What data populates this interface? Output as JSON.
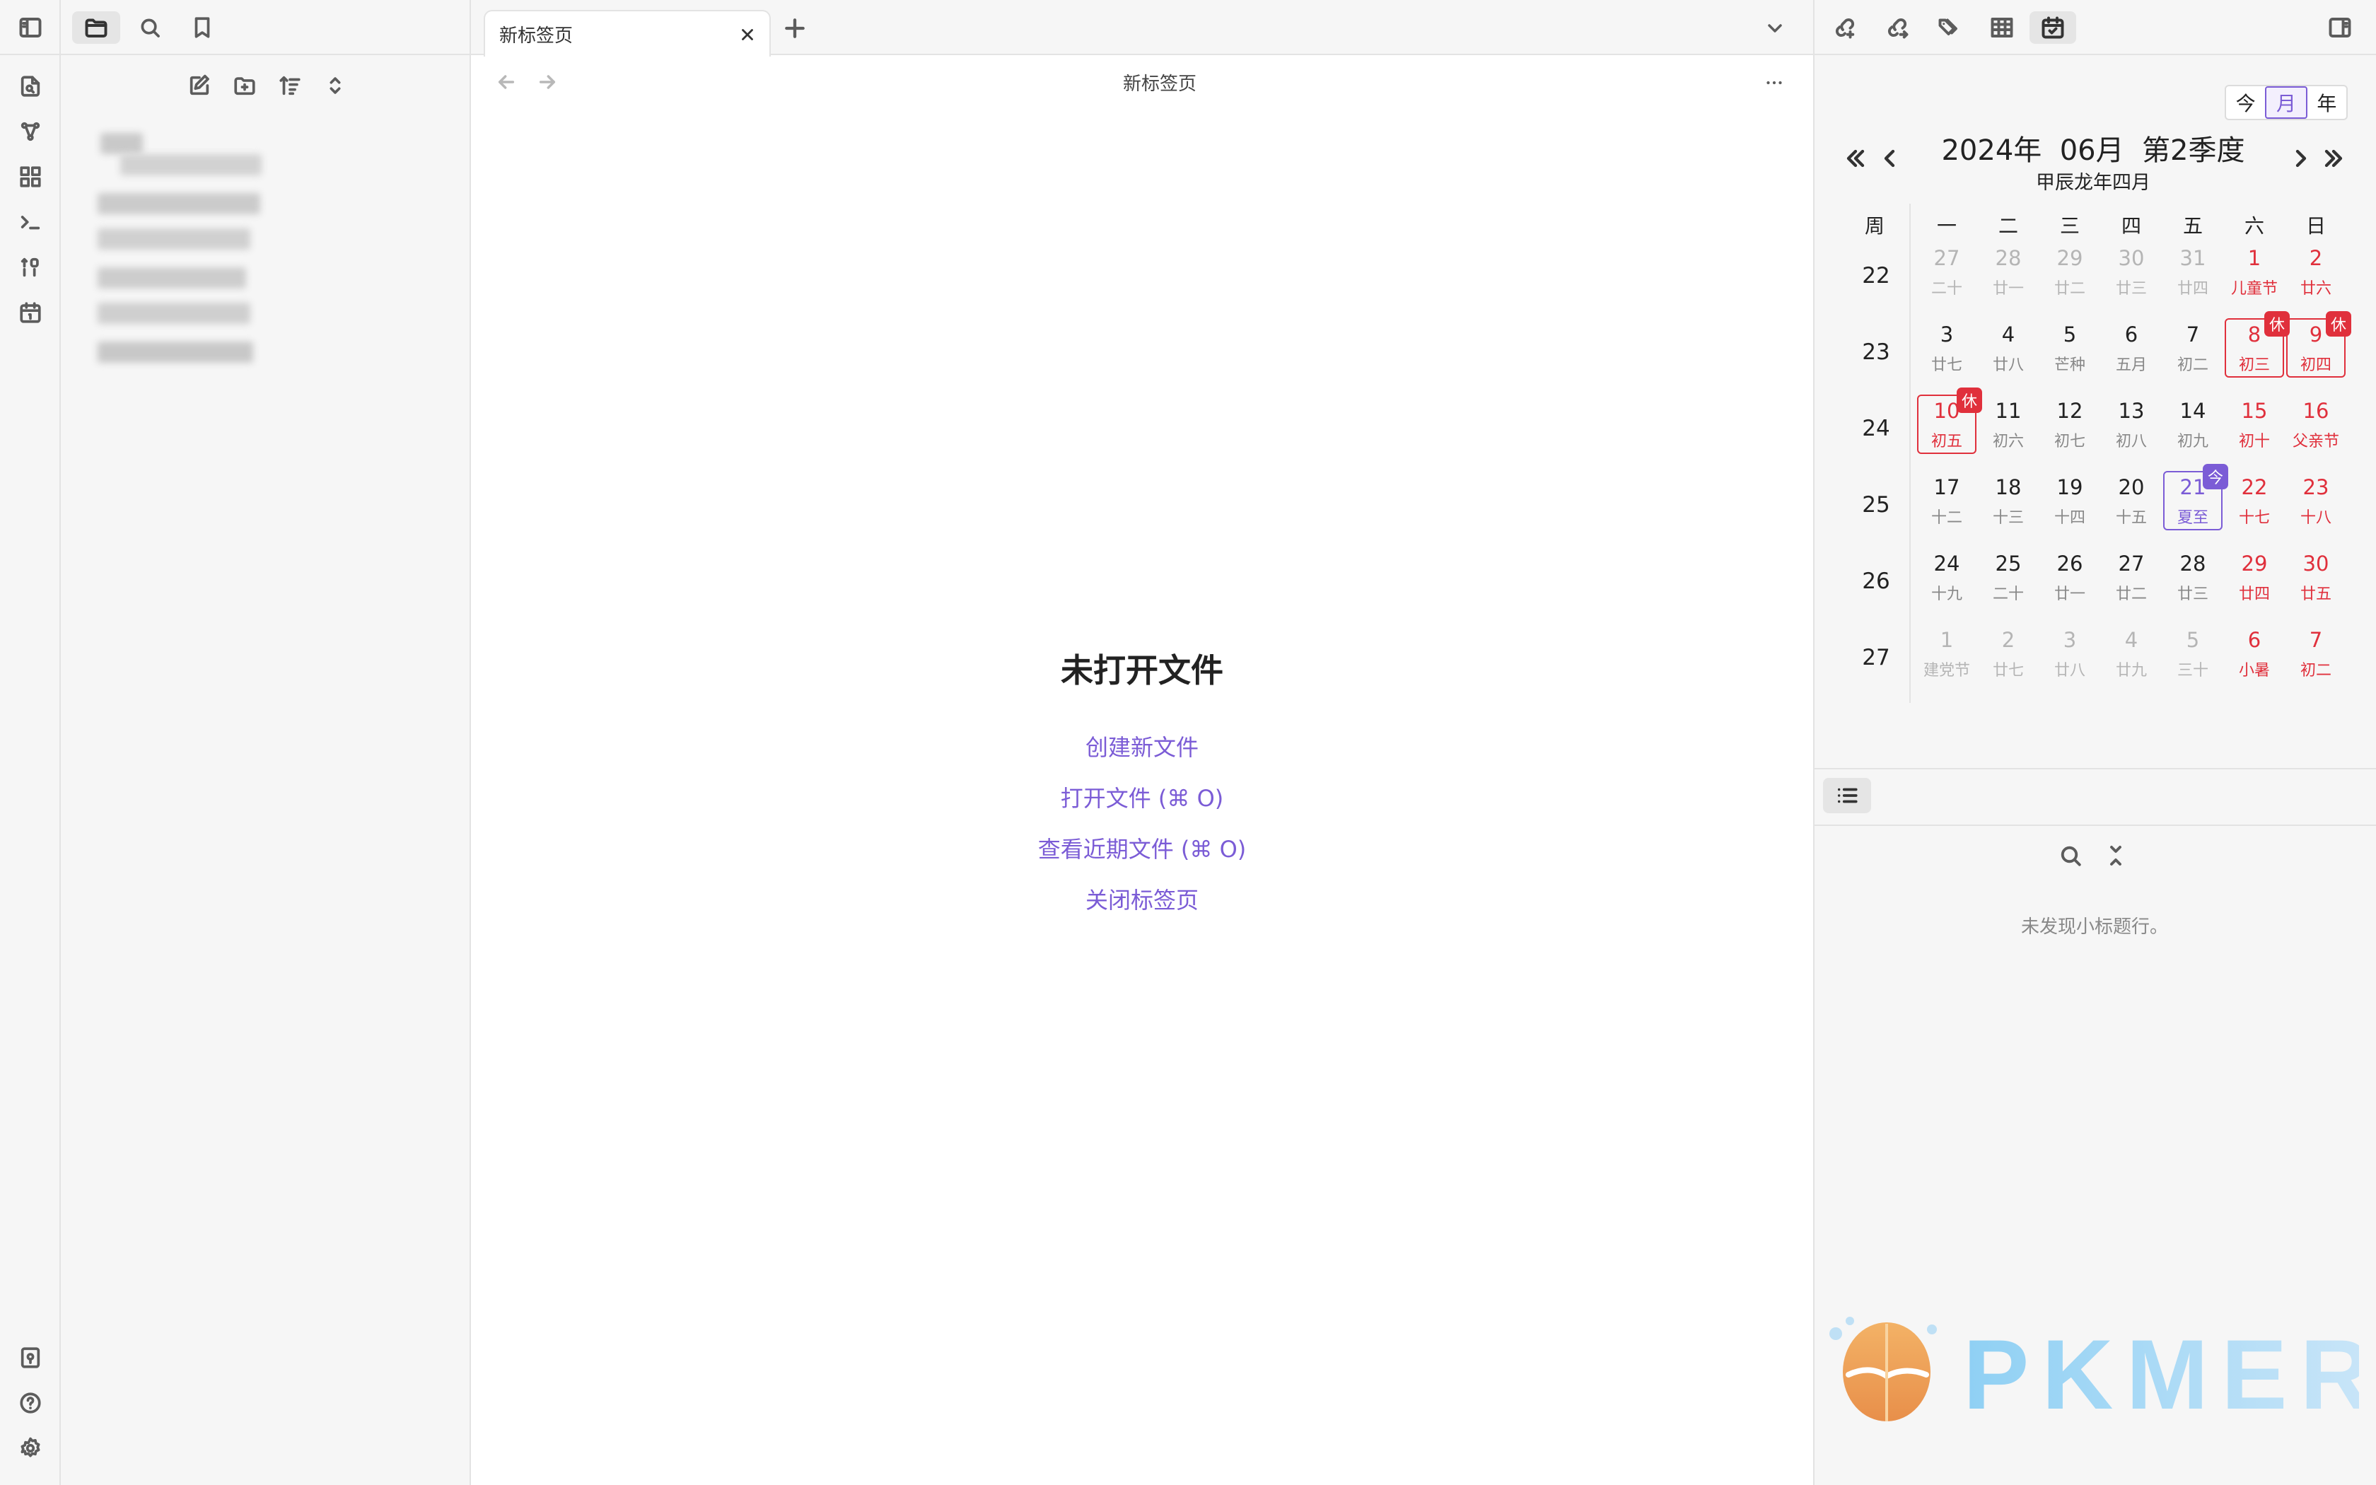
{
  "tabs": {
    "active_title": "新标签页"
  },
  "view": {
    "title": "新标签页"
  },
  "empty_state": {
    "title": "未打开文件",
    "links": [
      "创建新文件",
      "打开文件 (⌘ O)",
      "查看近期文件 (⌘ O)",
      "关闭标签页"
    ]
  },
  "calendar": {
    "view_modes": [
      "今",
      "月",
      "年"
    ],
    "active_mode": "月",
    "header": "2024年  06月  第2季度",
    "lunar_header": "甲辰龙年四月",
    "week_col": "周",
    "weekdays": [
      "一",
      "二",
      "三",
      "四",
      "五",
      "六",
      "日"
    ],
    "weeks": [
      "22",
      "23",
      "24",
      "25",
      "26",
      "27"
    ],
    "rest_badge": "休",
    "today_badge": "今",
    "days": [
      [
        "27",
        "二十"
      ],
      [
        "28",
        "廿一"
      ],
      [
        "29",
        "廿二"
      ],
      [
        "30",
        "廿三"
      ],
      [
        "31",
        "廿四"
      ],
      [
        "1",
        "儿童节"
      ],
      [
        "2",
        "廿六"
      ],
      [
        "3",
        "廿七"
      ],
      [
        "4",
        "廿八"
      ],
      [
        "5",
        "芒种"
      ],
      [
        "6",
        "五月"
      ],
      [
        "7",
        "初二"
      ],
      [
        "8",
        "初三"
      ],
      [
        "9",
        "初四"
      ],
      [
        "10",
        "初五"
      ],
      [
        "11",
        "初六"
      ],
      [
        "12",
        "初七"
      ],
      [
        "13",
        "初八"
      ],
      [
        "14",
        "初九"
      ],
      [
        "15",
        "初十"
      ],
      [
        "16",
        "父亲节"
      ],
      [
        "17",
        "十二"
      ],
      [
        "18",
        "十三"
      ],
      [
        "19",
        "十四"
      ],
      [
        "20",
        "十五"
      ],
      [
        "21",
        "夏至"
      ],
      [
        "22",
        "十七"
      ],
      [
        "23",
        "十八"
      ],
      [
        "24",
        "十九"
      ],
      [
        "25",
        "二十"
      ],
      [
        "26",
        "廿一"
      ],
      [
        "27",
        "廿二"
      ],
      [
        "28",
        "廿三"
      ],
      [
        "29",
        "廿四"
      ],
      [
        "30",
        "廿五"
      ],
      [
        "1",
        "建党节"
      ],
      [
        "2",
        "廿七"
      ],
      [
        "3",
        "廿八"
      ],
      [
        "4",
        "廿九"
      ],
      [
        "5",
        "三十"
      ],
      [
        "6",
        "小暑"
      ],
      [
        "7",
        "初二"
      ]
    ],
    "muted_days": [
      0,
      1,
      2,
      3,
      4,
      35,
      36,
      37,
      38,
      39
    ],
    "red_days": [
      5,
      6,
      12,
      13,
      14,
      19,
      20,
      26,
      27,
      33,
      34,
      40,
      41
    ],
    "holiday_days": [
      12,
      13,
      14
    ],
    "today_index": 25,
    "colors": {
      "accent": "#7b5cd6",
      "holiday": "#e0303c"
    }
  },
  "outline": {
    "empty_text": "未发现小标题行。"
  },
  "watermark": {
    "text": "PKMER"
  }
}
